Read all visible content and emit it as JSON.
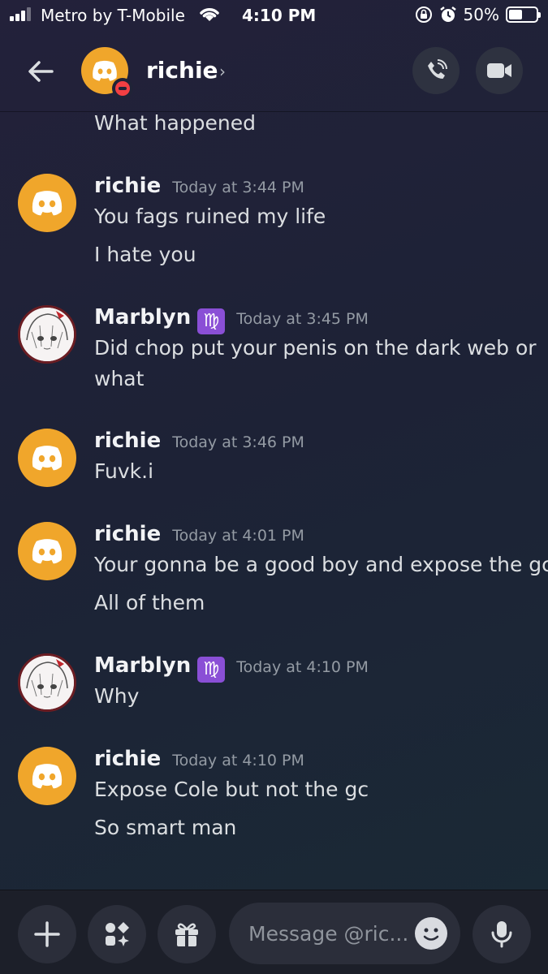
{
  "status_bar": {
    "carrier": "Metro by T-Mobile",
    "time": "4:10 PM",
    "battery_percent": "50%",
    "battery_level": 0.5,
    "icons": [
      "signal-icon",
      "wifi-icon",
      "orientation-lock-icon",
      "alarm-icon",
      "battery-icon"
    ]
  },
  "header": {
    "title": "richie",
    "chevron": "›",
    "icons": [
      "back-arrow-icon",
      "phone-call-icon",
      "video-camera-icon"
    ],
    "status": "do-not-disturb"
  },
  "messages": [
    {
      "continuation": true,
      "lines": [
        "What happened"
      ]
    },
    {
      "author": "richie",
      "timestamp": "Today at 3:44 PM",
      "avatar": "discord-default-avatar",
      "lines": [
        "You fags ruined my life",
        "I hate you"
      ]
    },
    {
      "author": "Marblyn",
      "badge": "♍",
      "timestamp": "Today at 3:45 PM",
      "avatar": "anime-avatar",
      "lines": [
        "Did chop put your penis on the dark web or",
        "what"
      ]
    },
    {
      "author": "richie",
      "timestamp": "Today at 3:46 PM",
      "avatar": "discord-default-avatar",
      "lines": [
        "Fuvk.i"
      ]
    },
    {
      "author": "richie",
      "timestamp": "Today at 4:01 PM",
      "avatar": "discord-default-avatar",
      "lines": [
        "Your gonna be a good boy and expose the gc",
        "All of them"
      ]
    },
    {
      "author": "Marblyn",
      "badge": "♍",
      "timestamp": "Today at 4:10 PM",
      "avatar": "anime-avatar",
      "lines": [
        "Why"
      ]
    },
    {
      "author": "richie",
      "timestamp": "Today at 4:10 PM",
      "avatar": "discord-default-avatar",
      "lines": [
        "Expose Cole but not the gc",
        "So smart man"
      ]
    }
  ],
  "composer": {
    "placeholder": "Message @ric...",
    "icons": [
      "plus-icon",
      "apps-icon",
      "gift-icon",
      "emoji-icon",
      "microphone-icon"
    ]
  },
  "colors": {
    "accent_orange": "#f0a62b",
    "dnd_red": "#f23f43",
    "virgo_purple": "#8a4fd6"
  }
}
